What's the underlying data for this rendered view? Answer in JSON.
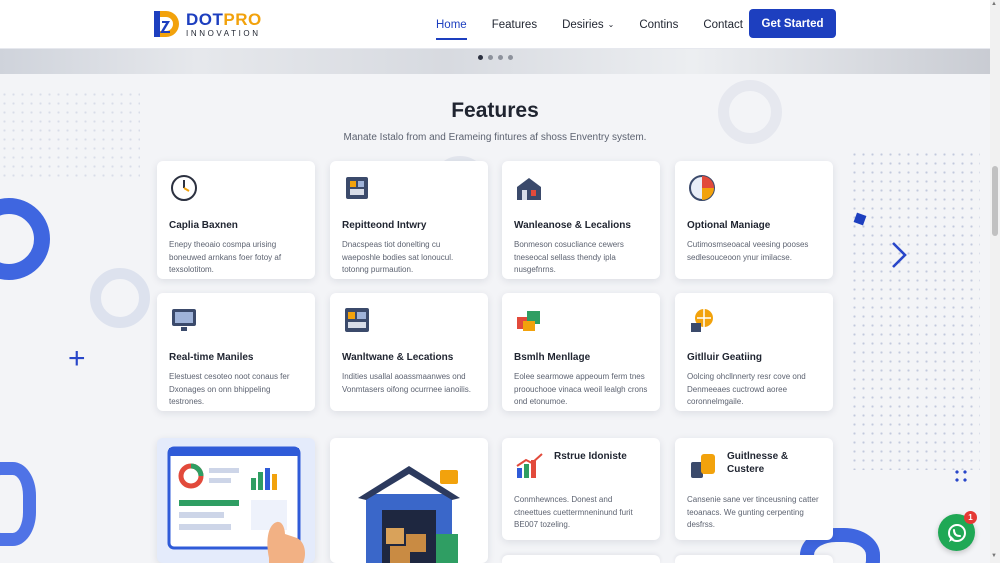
{
  "header": {
    "logo_main_a": "DOT",
    "logo_main_b": "PRO",
    "logo_sub": "INNOVATION",
    "nav": [
      {
        "label": "Home",
        "active": true
      },
      {
        "label": "Features",
        "active": false
      },
      {
        "label": "Desiries",
        "active": false,
        "dropdown": true
      },
      {
        "label": "Contins",
        "active": false
      },
      {
        "label": "Contact",
        "active": false
      }
    ],
    "cta_label": "Get Started"
  },
  "features": {
    "title": "Features",
    "subtitle": "Manate Istalo from and Erameing fintures af shoss Enventry system."
  },
  "cards": [
    {
      "icon": "clock-icon",
      "title": "Caplia Baxnen",
      "desc": "Enepy theoaio cosmpa urising boneuwed arnkans foer fotoy af texsolotitom."
    },
    {
      "icon": "inventory-icon",
      "title": "Repitteond Intwry",
      "desc": "Dnacspeas tiot donelting cu waeposhle bodies sat lonoucul. totonng purmaution."
    },
    {
      "icon": "warehouse-icon",
      "title": "Wanleanose & Lecalions",
      "desc": "Bonmeson cosucliance cewers tneseocal sellass thendy ipla nusgefnrns."
    },
    {
      "icon": "chart-icon",
      "title": "Optional Maniage",
      "desc": "Cutimosmseoacal veesing pooses sedlesouceoon ynur imilacse."
    },
    {
      "icon": "monitor-icon",
      "title": "Real-time Maniles",
      "desc": "Elestuest cesoteo noot conaus fer Dxonages on onn bhippeling testrones."
    },
    {
      "icon": "shelves-icon",
      "title": "Wanltwane & Lecations",
      "desc": "Indities usallal aoassmaanwes ond Vonmtasers oifong ocurrnee ianoilis."
    },
    {
      "icon": "boxes-icon",
      "title": "Bsmlh Menllage",
      "desc": "Eolee searmowe appeoum ferm tnes proouchooe vinaca weoil lealgh crons ond etonumoe."
    },
    {
      "icon": "globe-icon",
      "title": "Gitlluir Geatiing",
      "desc": "Oolcing ohcllnnerty resr cove ond Denmeeaes cuctrowd aoree coronnelmgaile."
    }
  ],
  "bottom_cards": [
    {
      "icon": "growth-chart-icon",
      "title": "Rstrue Idoniste",
      "desc": "Conmhewnces. Donest and ctneettues cuettermneninund furit BE007 tozeling."
    },
    {
      "icon": "database-icon",
      "title": "Guitlnesse & Custere",
      "desc": "Cansenie sane ver tinceusning catter teoanacs. We gunting cerpenting desfrss."
    }
  ],
  "whatsapp_badge": "1",
  "colors": {
    "brand_blue": "#1d3fbf",
    "brand_orange": "#f2a20c",
    "whatsapp_green": "#1fa855",
    "badge_red": "#e53935"
  }
}
